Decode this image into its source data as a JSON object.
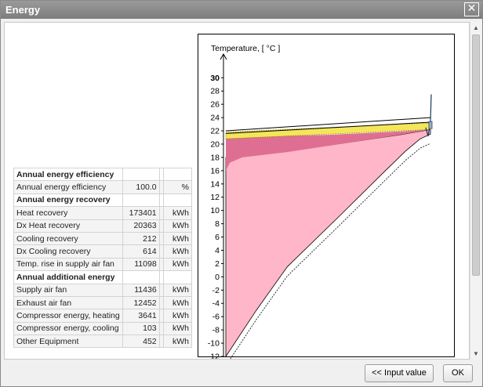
{
  "window": {
    "title": "Energy"
  },
  "buttons": {
    "input_value": "<< Input value",
    "ok": "OK"
  },
  "table": {
    "rows": [
      {
        "type": "header",
        "label": "Annual energy efficiency"
      },
      {
        "type": "row",
        "label": "Annual energy efficiency",
        "value": "100.0",
        "unit": "%"
      },
      {
        "type": "header",
        "label": "Annual energy recovery"
      },
      {
        "type": "row",
        "label": "Heat recovery",
        "value": "173401",
        "unit": "kWh"
      },
      {
        "type": "row",
        "label": "Dx Heat recovery",
        "value": "20363",
        "unit": "kWh"
      },
      {
        "type": "row",
        "label": "Cooling recovery",
        "value": "212",
        "unit": "kWh"
      },
      {
        "type": "row",
        "label": "Dx Cooling recovery",
        "value": "614",
        "unit": "kWh"
      },
      {
        "type": "row",
        "label": "Temp. rise in supply air fan",
        "value": "11098",
        "unit": "kWh"
      },
      {
        "type": "header",
        "label": "Annual additional energy"
      },
      {
        "type": "row",
        "label": "Supply air fan",
        "value": "11436",
        "unit": "kWh"
      },
      {
        "type": "row",
        "label": "Exhaust air fan",
        "value": "12452",
        "unit": "kWh"
      },
      {
        "type": "row",
        "label": "Compressor energy, heating",
        "value": "3641",
        "unit": "kWh"
      },
      {
        "type": "row",
        "label": "Compressor energy, cooling",
        "value": "103",
        "unit": "kWh"
      },
      {
        "type": "row",
        "label": "Other Equipment",
        "value": "452",
        "unit": "kWh"
      }
    ]
  },
  "chart_data": {
    "type": "area",
    "ylabel": "Temperature, [ °C ]",
    "yticks": [
      30,
      28,
      26,
      24,
      22,
      20,
      18,
      16,
      14,
      12,
      10,
      8,
      6,
      4,
      2,
      0,
      -2,
      -4,
      -6,
      -8,
      -10,
      -12
    ],
    "ylim": [
      -12,
      32
    ],
    "grid": false,
    "x_range": [
      0,
      100
    ],
    "series": [
      {
        "color": "#ffb6c8",
        "upper": [
          [
            0,
            18
          ],
          [
            50,
            19.8
          ],
          [
            85,
            21.4
          ],
          [
            100,
            22.2
          ]
        ],
        "lower": [
          [
            0,
            -12
          ],
          [
            15,
            -5
          ],
          [
            30,
            1.5
          ],
          [
            55,
            9
          ],
          [
            78,
            16
          ],
          [
            88,
            19
          ],
          [
            95,
            20.8
          ],
          [
            100,
            21.5
          ]
        ]
      },
      {
        "color": "#de6f93",
        "upper": [
          [
            0,
            21
          ],
          [
            50,
            21.4
          ],
          [
            85,
            21.9
          ],
          [
            100,
            22.2
          ]
        ],
        "lower": [
          [
            0,
            16
          ],
          [
            2,
            17.2
          ],
          [
            8,
            18
          ],
          [
            30,
            18.8
          ],
          [
            60,
            20.2
          ],
          [
            85,
            21.4
          ],
          [
            100,
            22.2
          ]
        ]
      },
      {
        "color": "#f4e65a",
        "upper": [
          [
            0,
            21.8
          ],
          [
            100,
            23.2
          ]
        ],
        "lower": [
          [
            0,
            20.8
          ],
          [
            100,
            22.2
          ]
        ]
      }
    ],
    "lines": [
      {
        "color": "#000000",
        "points": [
          [
            0,
            22
          ],
          [
            100,
            24
          ]
        ]
      },
      {
        "color": "#000000",
        "points": [
          [
            0,
            21.6
          ],
          [
            100,
            23.3
          ]
        ]
      }
    ],
    "colors": {
      "outdoor_line": "#000000",
      "exhaust_line": "#1a3a5a"
    }
  }
}
